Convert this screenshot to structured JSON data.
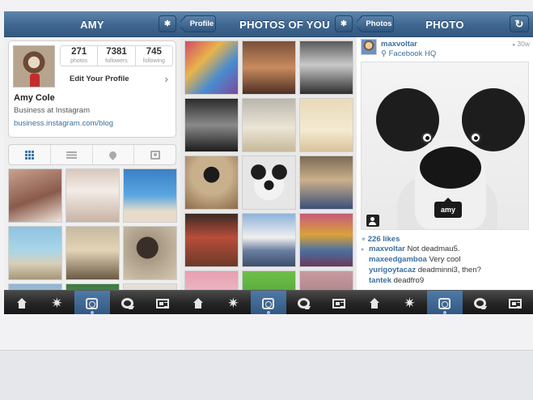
{
  "panels": {
    "profile": {
      "title": "AMY",
      "stats": [
        {
          "num": "271",
          "label": "photos"
        },
        {
          "num": "7381",
          "label": "followers"
        },
        {
          "num": "745",
          "label": "following"
        }
      ],
      "edit_label": "Edit Your Profile",
      "name": "Amy Cole",
      "bio": "Business at Instagram",
      "link": "business.instagram.com/blog",
      "view_tabs": [
        "grid-icon",
        "list-icon",
        "map-pin-icon",
        "tagged-photos-icon"
      ]
    },
    "photos_of_you": {
      "back_label": "Profile",
      "title": "PHOTOS OF YOU"
    },
    "photo": {
      "back_label": "Photos",
      "title": "PHOTO",
      "username": "maxvoltar",
      "location": "Facebook HQ",
      "time": "30w",
      "tag_label": "amy",
      "likes": "226 likes",
      "comments": [
        {
          "user": "maxvoltar",
          "text": "Not deadmau5."
        },
        {
          "user": "maxeedgamboa",
          "text": "Very cool"
        },
        {
          "user": "yurigoytacaz",
          "text": "deadminni3, then?"
        },
        {
          "user": "tantek",
          "text": "deadfro9"
        }
      ]
    }
  },
  "tabbar": [
    "home-icon",
    "explore-icon",
    "camera-icon",
    "news-icon",
    "profile-icon"
  ],
  "icon_glyphs": {
    "gear": "✱",
    "refresh": "↻",
    "star": "✷",
    "location_pin": "⚲",
    "chevron": "›",
    "clock": "●",
    "heart": "♥",
    "comment": "●"
  },
  "colors": {
    "navbar": "#3f6690",
    "link": "#3a6f9f",
    "tabbar": "#262626",
    "active_tab": "#3d6c99"
  }
}
